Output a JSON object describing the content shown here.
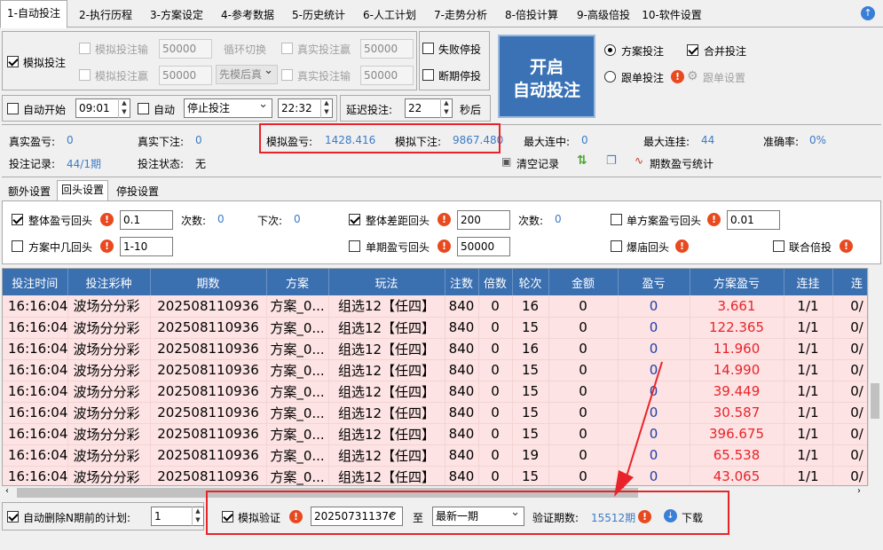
{
  "tabs": [
    "1-自动投注",
    "2-执行历程",
    "3-方案设定",
    "4-参考数据",
    "5-历史统计",
    "6-人工计划",
    "7-走势分析",
    "8-倍投计算",
    "9-高级倍投",
    "10-软件设置"
  ],
  "sim": {
    "label": "模拟投注",
    "sim_bet_lose": "模拟投注输",
    "sim_bet_win": "模拟投注赢",
    "val1": "50000",
    "val2": "50000",
    "cycle": "循环切换",
    "order": "先模后真",
    "real_bet_win": "真实投注赢",
    "real_bet_lose": "真实投注输",
    "rval1": "50000",
    "rval2": "50000",
    "fail_stop": "失败停投",
    "break_stop": "断期停投"
  },
  "big_button": {
    "line1": "开启",
    "line2": "自动投注"
  },
  "right_opts": {
    "plan_bet": "方案投注",
    "merge_bet": "合并投注",
    "follow_bet": "跟单投注",
    "follow_settings": "跟单设置"
  },
  "auto": {
    "auto_start": "自动开始",
    "start_time": "09:01",
    "auto": "自动",
    "stop_mode": "停止投注",
    "end_time": "22:32",
    "delay_label": "延迟投注:",
    "delay_val": "22",
    "seconds": "秒后"
  },
  "stats": {
    "real_pl_label": "真实盈亏:",
    "real_pl": "0",
    "real_bet_label": "真实下注:",
    "real_bet": "0",
    "sim_pl_label": "模拟盈亏:",
    "sim_pl": "1428.416",
    "sim_bet_label": "模拟下注:",
    "sim_bet": "9867.480",
    "max_hit_label": "最大连中:",
    "max_hit": "0",
    "max_streak_label": "最大连挂:",
    "max_streak": "44",
    "accuracy_label": "准确率:",
    "accuracy": "0%",
    "record_label": "投注记录:",
    "record": "44/1期",
    "status_label": "投注状态:",
    "status": "无",
    "clear": "清空记录",
    "period_stats": "期数盈亏统计"
  },
  "subtabs": [
    "额外设置",
    "回头设置",
    "停投设置"
  ],
  "settings": {
    "total_pl_back": "整体盈亏回头",
    "total_pl_val": "0.1",
    "count_label": "次数:",
    "count1": "0",
    "next_label": "下次:",
    "next1": "0",
    "total_diff_back": "整体差距回头",
    "diff_val": "200",
    "count2": "0",
    "single_plan_back": "单方案盈亏回头",
    "single_plan_val": "0.01",
    "plan_hit_back": "方案中几回头",
    "plan_hit_val": "1-10",
    "single_period_back": "单期盈亏回头",
    "single_period_val": "50000",
    "burst_back": "爆庙回头",
    "joint_multi": "联合倍投"
  },
  "table": {
    "headers": [
      "投注时间",
      "投注彩种",
      "期数",
      "方案",
      "玩法",
      "注数",
      "倍数",
      "轮次",
      "金额",
      "盈亏",
      "方案盈亏",
      "连挂",
      "连"
    ],
    "rows": [
      [
        "16:16:04",
        "波场分分彩",
        "202508110936",
        "方案_0...",
        "组选12【任四】",
        "840",
        "0",
        "16",
        "0",
        "0",
        "3.661",
        "1/1",
        "0/"
      ],
      [
        "16:16:04",
        "波场分分彩",
        "202508110936",
        "方案_0...",
        "组选12【任四】",
        "840",
        "0",
        "15",
        "0",
        "0",
        "122.365",
        "1/1",
        "0/"
      ],
      [
        "16:16:04",
        "波场分分彩",
        "202508110936",
        "方案_0...",
        "组选12【任四】",
        "840",
        "0",
        "16",
        "0",
        "0",
        "11.960",
        "1/1",
        "0/"
      ],
      [
        "16:16:04",
        "波场分分彩",
        "202508110936",
        "方案_0...",
        "组选12【任四】",
        "840",
        "0",
        "15",
        "0",
        "0",
        "14.990",
        "1/1",
        "0/"
      ],
      [
        "16:16:04",
        "波场分分彩",
        "202508110936",
        "方案_0...",
        "组选12【任四】",
        "840",
        "0",
        "15",
        "0",
        "0",
        "39.449",
        "1/1",
        "0/"
      ],
      [
        "16:16:04",
        "波场分分彩",
        "202508110936",
        "方案_0...",
        "组选12【任四】",
        "840",
        "0",
        "15",
        "0",
        "0",
        "30.587",
        "1/1",
        "0/"
      ],
      [
        "16:16:04",
        "波场分分彩",
        "202508110936",
        "方案_0...",
        "组选12【任四】",
        "840",
        "0",
        "15",
        "0",
        "0",
        "396.675",
        "1/1",
        "0/"
      ],
      [
        "16:16:04",
        "波场分分彩",
        "202508110936",
        "方案_0...",
        "组选12【任四】",
        "840",
        "0",
        "19",
        "0",
        "0",
        "65.538",
        "1/1",
        "0/"
      ],
      [
        "16:16:04",
        "波场分分彩",
        "202508110936",
        "方案_0...",
        "组选12【任四】",
        "840",
        "0",
        "15",
        "0",
        "0",
        "43.065",
        "1/1",
        "0/"
      ]
    ]
  },
  "bottom": {
    "auto_delete": "自动删除N期前的计划:",
    "auto_delete_val": "1",
    "sim_verify": "模拟验证",
    "from_period": "20250731137€",
    "to_label": "至",
    "to_period": "最新一期",
    "verify_count_label": "验证期数:",
    "verify_count": "15512期",
    "download": "下载"
  },
  "colors": {
    "accent": "#3a72b5",
    "highlight": "#e8242a",
    "header": "#3a6fb0",
    "row_bg": "#fde3e3"
  }
}
